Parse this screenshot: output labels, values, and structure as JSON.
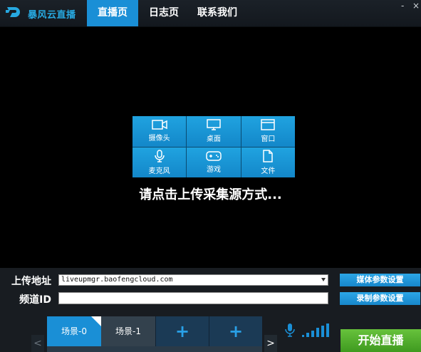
{
  "app": {
    "title": "暴风云直播"
  },
  "tabs": [
    {
      "label": "直播页"
    },
    {
      "label": "日志页"
    },
    {
      "label": "联系我们"
    }
  ],
  "window": {
    "minimize": "-",
    "close": "×"
  },
  "sources": [
    {
      "label": "摄像头",
      "icon": "camera-icon"
    },
    {
      "label": "桌面",
      "icon": "monitor-icon"
    },
    {
      "label": "窗口",
      "icon": "window-icon"
    },
    {
      "label": "麦克风",
      "icon": "microphone-icon"
    },
    {
      "label": "游戏",
      "icon": "gamepad-icon"
    },
    {
      "label": "文件",
      "icon": "file-icon"
    }
  ],
  "hint": "请点击上传采集源方式...",
  "upload": {
    "label": "上传地址",
    "value": "liveupmgr.baofengcloud.com"
  },
  "channel": {
    "label": "频道ID",
    "value": ""
  },
  "buttons": {
    "media_params": "媒体参数设置",
    "record_params": "录制参数设置",
    "start_live": "开始直播"
  },
  "scenes": [
    {
      "label": "场景-0"
    },
    {
      "label": "场景-1"
    },
    {
      "label": "+"
    },
    {
      "label": "+"
    }
  ],
  "nav": {
    "prev": "<",
    "next": ">"
  },
  "colors": {
    "accent": "#1a8fd6",
    "start": "#4caf2a",
    "background": "#000000"
  }
}
